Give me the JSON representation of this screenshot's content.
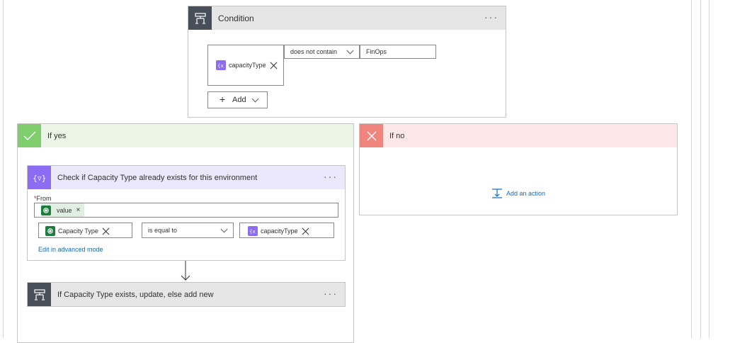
{
  "condition": {
    "title": "Condition",
    "token_label": "capacityType",
    "operator": "does not contain",
    "value": "FinOps",
    "add_label": "Add"
  },
  "if_yes": {
    "label": "If yes",
    "filter": {
      "title": "Check if Capacity Type already exists for this environment",
      "from_required": "*",
      "from_label": "From",
      "from_token": "value",
      "left_token": "Capacity Type",
      "operator": "is equal to",
      "right_token": "capacityType",
      "advanced_link": "Edit in advanced mode"
    },
    "nested": {
      "title": "If Capacity Type exists, update, else add new"
    }
  },
  "if_no": {
    "label": "If no",
    "add_action": "Add an action"
  },
  "icons": {
    "condition": "condition-icon",
    "expression": "expression-icon",
    "dataverse": "dataverse-icon",
    "check": "checkmark-icon",
    "cross": "cross-icon",
    "add_action": "add-action-icon"
  },
  "colors": {
    "condition_header": "#e6e6e6",
    "condition_icon_bg": "#484f58",
    "yes_header": "#eaf5e6",
    "yes_icon_bg": "#7fcd6d",
    "no_header": "#fde7e9",
    "no_icon_bg": "#f0857d",
    "filter_header": "#ece8fc",
    "filter_icon_bg": "#8c6cf2",
    "dataverse": "#1e7d3e",
    "link": "#0f6cbd"
  }
}
